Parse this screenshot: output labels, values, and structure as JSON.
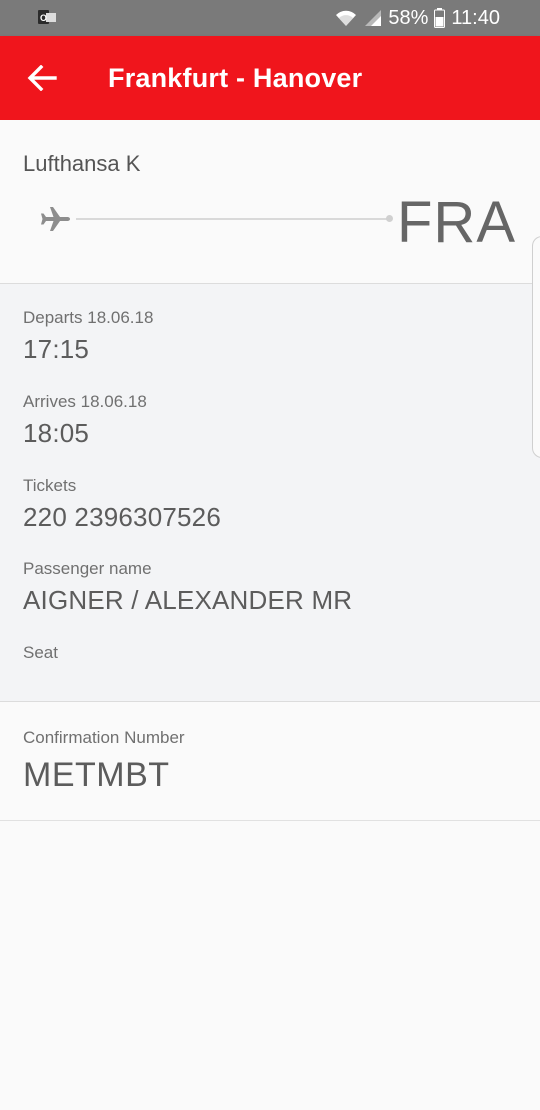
{
  "status_bar": {
    "battery_percent": "58%",
    "time": "11:40",
    "icons": [
      "outlook-icon",
      "wifi-icon",
      "signal-icon",
      "battery-icon"
    ]
  },
  "app_bar": {
    "title": "Frankfurt - Hanover",
    "back_icon": "arrow-back-icon",
    "background_color": "#f0151c"
  },
  "flight": {
    "airline": "Lufthansa K",
    "airport_code": "FRA",
    "plane_icon": "airplane-icon"
  },
  "details": {
    "departs_label": "Departs 18.06.18",
    "departs_time": "17:15",
    "arrives_label": "Arrives 18.06.18",
    "arrives_time": "18:05",
    "tickets_label": "Tickets",
    "tickets_value": "220 2396307526",
    "passenger_label": "Passenger name",
    "passenger_value": "AIGNER / ALEXANDER MR",
    "seat_label": "Seat",
    "seat_value": ""
  },
  "confirmation": {
    "label": "Confirmation Number",
    "value": "METMBT"
  }
}
